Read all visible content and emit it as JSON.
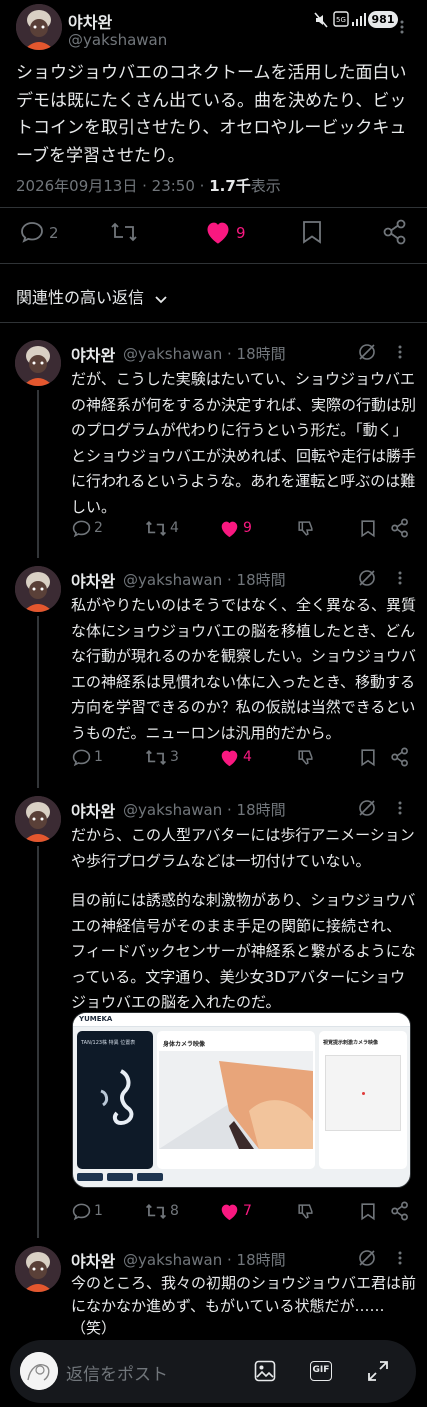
{
  "status_bar": {
    "battery": "981"
  },
  "main_post": {
    "author": "야차완",
    "handle": "@yakshawan",
    "text": "ショウジョウバエのコネクトームを活用した面白いデモは既にたくさん出ている。曲を決めたり、ビットコインを取引させたり、オセロやルービックキューブを学習させたり。",
    "date": "2026年09月13日 · 23:50 · ",
    "views_count": "1.7千",
    "views_label": "表示",
    "replies": "2",
    "likes": "9"
  },
  "replies_filter": {
    "label": "関連性の高い返信"
  },
  "replies": [
    {
      "author": "야차완",
      "handle": "@yakshawan · 18時間",
      "text": "だが、こうした実験はたいてい、ショウジョウバエの神経系が何をするか決定すれば、実際の行動は別のプログラムが代わりに行うという形だ。「動く」とショウジョウバエが決めれば、回転や走行は勝手に行われるというような。あれを運転と呼ぶのは難しい。",
      "replies": "2",
      "reposts": "4",
      "likes": "9"
    },
    {
      "author": "야차완",
      "handle": "@yakshawan · 18時間",
      "text": "私がやりたいのはそうではなく、全く異なる、異質な体にショウジョウバエの脳を移植したとき、どんな行動が現れるのかを観察したい。ショウジョウバエの神経系は見慣れない体に入ったとき、移動する方向を学習できるのか？私の仮説は当然できるというものだ。ニューロンは汎用的だから。",
      "replies": "1",
      "reposts": "3",
      "likes": "4"
    },
    {
      "author": "야차완",
      "handle": "@yakshawan · 18時間",
      "text_1": "だから、この人型アバターには歩行アニメーションや歩行プログラムなどは一切付けていない。",
      "text_2": "目の前には誘惑的な刺激物があり、ショウジョウバエの神経信号がそのまま手足の関節に接続され、フィードバックセンサーが神経系と繋がるようになっている。文字通り、美少女3Dアバターにショウジョウバエの脳を入れたのだ。",
      "replies": "1",
      "reposts": "8",
      "likes": "7",
      "media": {
        "brand": "YUMEKA",
        "panel_left_title": "TAN/123株 特異 位置表",
        "panel_mid_title": "身体カメラ映像",
        "panel_right_title": "視覚提示刺激カメラ映像"
      }
    },
    {
      "author": "야차완",
      "handle": "@yakshawan · 18時間",
      "text": "今のところ、我々の初期のショウジョウバエ君は前になかなか進めず、もがいている状態だが……（笑）\nこれからも訓練を続けて結果を見守るつもりだ。"
    }
  ],
  "composer": {
    "placeholder": "返信をポスト",
    "gif_label": "GIF"
  },
  "colors": {
    "like": "#f91880",
    "muted": "#71767b",
    "text": "#e7e9ea"
  }
}
